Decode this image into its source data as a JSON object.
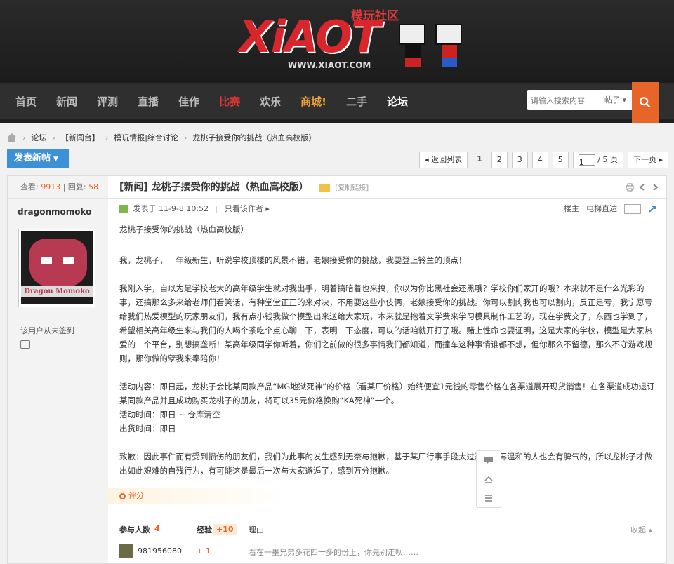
{
  "header": {
    "logo_sub": "模玩社区",
    "logo_main": "XiAOT",
    "logo_url": "WWW.XIAOT.COM"
  },
  "nav": {
    "items": [
      {
        "label": "首页"
      },
      {
        "label": "新闻"
      },
      {
        "label": "评测"
      },
      {
        "label": "直播"
      },
      {
        "label": "佳作"
      },
      {
        "label": "比赛"
      },
      {
        "label": "欢乐"
      },
      {
        "label": "商城!"
      },
      {
        "label": "二手"
      },
      {
        "label": "论坛"
      }
    ],
    "search_placeholder": "请输入搜索内容",
    "search_scope": "帖子 ▾"
  },
  "breadcrumb": [
    "论坛",
    "【新闻台】",
    "模玩情报|综合讨论",
    "龙桃子接受你的挑战（热血高校版）"
  ],
  "toolbar": {
    "post_button": "发表新帖",
    "back_to_list": "◂ 返回列表",
    "pages": [
      "1",
      "2",
      "3",
      "4",
      "5"
    ],
    "page_input": "1",
    "page_total": "/ 5 页",
    "next_page": "下一页 ▸"
  },
  "side": {
    "views_label": "查看:",
    "views": "9913",
    "replies_label": "| 回复:",
    "replies": "58",
    "author": "dragonmomoko",
    "avatar_text": "Dragon Momoko",
    "checkin": "该用户从未签到"
  },
  "thread": {
    "title": "[新闻] 龙桃子接受你的挑战（热血高校版）",
    "copy_link": "[复制链接]"
  },
  "meta": {
    "posted": "发表于 11-9-8 10:52",
    "only_author": "只看该作者 ▸",
    "floor": "楼主",
    "jump": "电梯直达"
  },
  "body": {
    "p1": "龙桃子接受你的挑战（热血高校版）",
    "p2": "我，龙桃子，一年级新生，听说学校顶楼的风景不错，老娘接受你的挑战，我要登上铃兰的顶点！",
    "p3": "我刚入学，自以为是学校老大的高年级学生就对我出手，明着搞暗着也来搞，你以为你比黑社会还黑哦？学校你们家开的哦？本来就不是什么光彩的事，还搞那么多来给老师们看笑话，有种堂堂正正的来对决，不用要这些小伎俩，老娘接受你的挑战。你可以割肉我也可以割肉，反正是亏，我宁愿亏给我们热爱模型的玩家朋友们，我有点小钱我做个模型出来送给大家玩，本来就是抱着文学费来学习模具制作工艺的，现在学费交了，东西也学到了，希望相关高年级生来与我们的人喝个茶吃个点心聊一下，表明一下态度，可以的话咱就开打了哦。赌上性命也要证明，这是大家的学校，模型是大家热爱的一个平台，别想搞垄断！某高年级同学你听着，你们之前做的很多事情我们都知道，而撞车这种事情谁都不想，但你那么不留德，那么不守游戏规则，那你做的孽我来奉陪你！",
    "p4a": "活动内容：即日起，龙桃子会比某同款产品“MG地狱死神”的价格（看某厂价格）始终便宜1元钱的零售价格在各渠道展开现货销售！在各渠道成功退订某同款产品并且成功购买龙桃子的朋友，将可以35元价格换购“KA死神”一个。",
    "p4b": "活动时间：即日 ~ 仓库清空",
    "p4c": "出货时间：即日",
    "p5": "致歉：因此事件而有受到损伤的朋友们，我们为此事的发生感到无奈与抱歉，基于某厂行事手段太过恶意，再温和的人也会有脾气的，所以龙桃子才做出如此艰难的自残行为，有可能这是最后一次与大家邂逅了，感到万分抱歉。"
  },
  "rating": {
    "label": "评分",
    "participants_label": "参与人数",
    "participants": "4",
    "exp_label": "经验",
    "exp_total": "+10",
    "reason_label": "理由",
    "collapse": "收起 ▴",
    "rows": [
      {
        "user": "981956080",
        "exp": "+ 1",
        "reason": "看在一墨兄弟多花四十多的份上，你先别走呗……"
      }
    ]
  },
  "colors": {
    "accent": "#e8652a",
    "brand_red": "#d9262c",
    "post_button": "#3d8fd6"
  }
}
